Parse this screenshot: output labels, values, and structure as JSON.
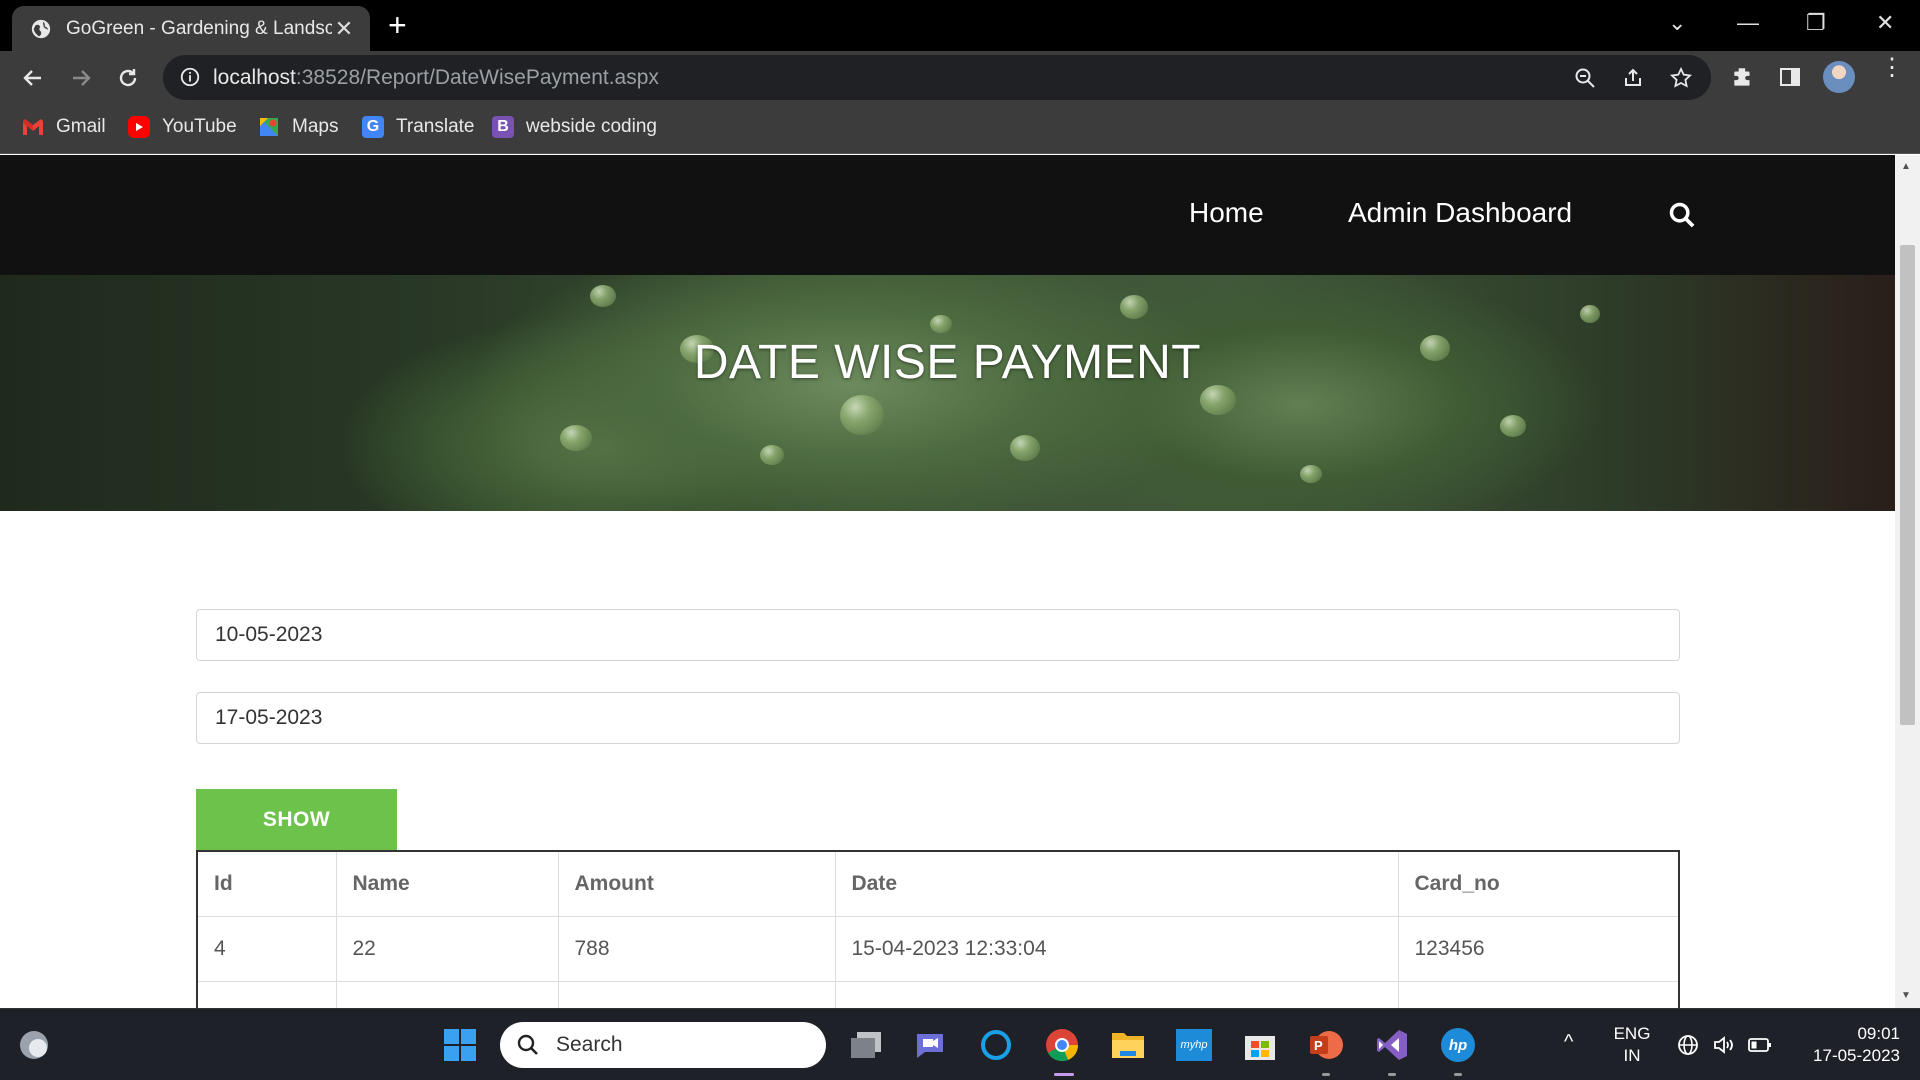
{
  "browser": {
    "tab_title": "GoGreen - Gardening & Landscap",
    "url_host": "localhost",
    "url_path": ":38528/Report/DateWisePayment.aspx",
    "bookmarks": [
      "Gmail",
      "YouTube",
      "Maps",
      "Translate",
      "webside coding"
    ]
  },
  "site": {
    "nav": {
      "home": "Home",
      "admin": "Admin Dashboard"
    },
    "hero_title": "DATE WISE PAYMENT"
  },
  "form": {
    "from_date": "10-05-2023",
    "to_date": "17-05-2023",
    "show_label": "SHOW"
  },
  "table": {
    "headers": [
      "Id",
      "Name",
      "Amount",
      "Date",
      "Card_no"
    ],
    "rows": [
      [
        "4",
        "22",
        "788",
        "15-04-2023 12:33:04",
        "123456"
      ],
      [
        "",
        "",
        "",
        "",
        ""
      ]
    ]
  },
  "taskbar": {
    "search_placeholder": "Search",
    "lang": "ENG",
    "region": "IN",
    "time": "09:01",
    "date": "17-05-2023"
  },
  "colors": {
    "accent_green": "#6cc24a",
    "nav_bg": "#111111"
  }
}
